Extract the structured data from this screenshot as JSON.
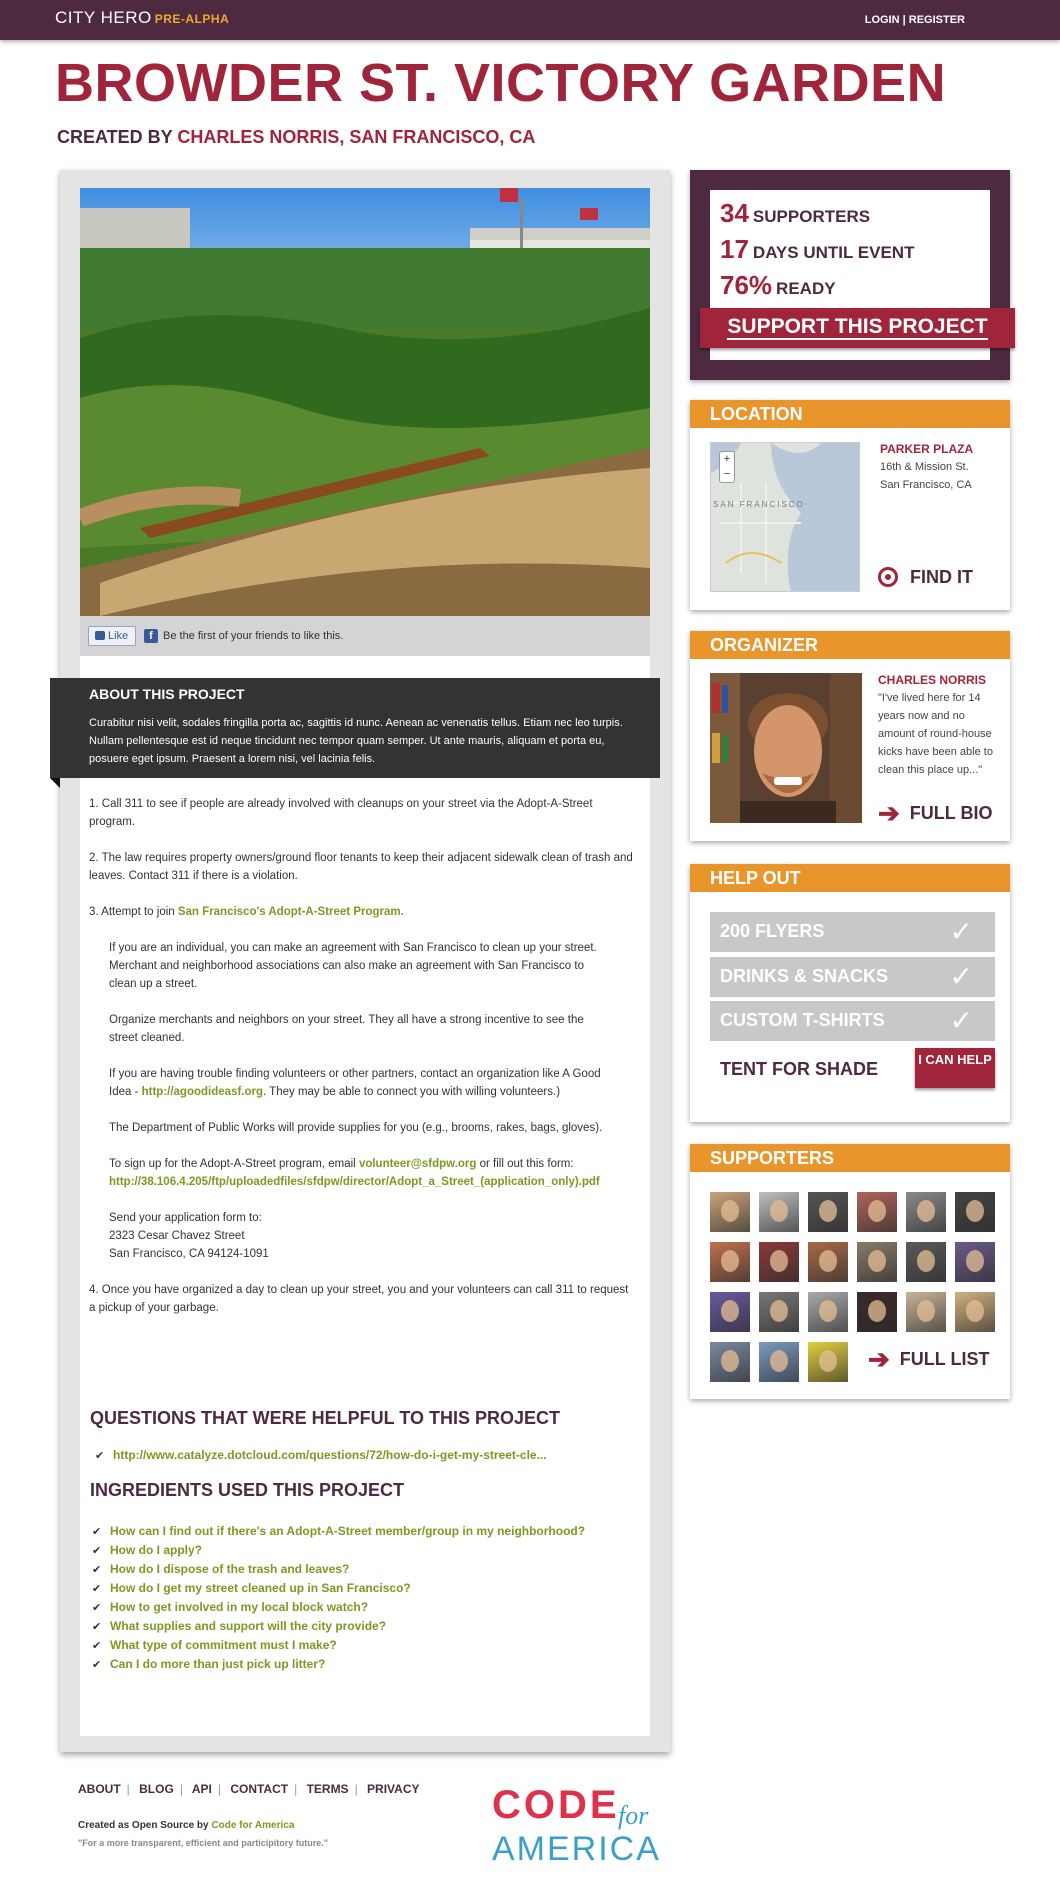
{
  "topbar": {
    "brand": "CITY HERO",
    "badge": "PRE-ALPHA",
    "login": "LOGIN",
    "separator": "|",
    "register": "REGISTER"
  },
  "project": {
    "title": "BROWDER ST. VICTORY GARDEN",
    "created_by_label": "CREATED BY",
    "creator": "CHARLES NORRIS, SAN FRANCISCO, CA"
  },
  "like_bar": {
    "button": "Like",
    "text": "Be the first of your friends to like this."
  },
  "about": {
    "heading": "ABOUT THIS PROJECT",
    "text": "Curabitur nisi velit, sodales fringilla porta ac, sagittis id nunc. Aenean ac venenatis tellus. Etiam nec leo turpis. Nullam pellentesque est id neque tincidunt nec tempor quam semper. Ut ante mauris, aliquam et porta eu, posuere eget ipsum. Praesent a lorem nisi, vel lacinia felis."
  },
  "steps": {
    "s1": "1. Call 311 to see if people are already involved with cleanups on your street via the Adopt-A-Street program.",
    "s2": "2. The law requires property owners/ground floor tenants to keep their adjacent sidewalk clean of trash and leaves. Contact 311 if there is a violation.",
    "s3_prefix": "3. Attempt to join ",
    "s3_link": "San Francisco's Adopt-A-Street Program.",
    "p1": "If you are an individual, you can make an agreement with San Francisco to clean up your street. Merchant and neighborhood associations can also make an agreement with San Francisco to clean up a street.",
    "p2": "Organize merchants and neighbors on your street. They all have a strong incentive to see the street cleaned.",
    "p3_prefix": "If you are having trouble finding volunteers or other partners, contact an organization like A Good Idea - ",
    "p3_link": "http://agoodideasf.org",
    "p3_suffix": ". They may be able to connect you with willing volunteers.)",
    "p4": "The Department of Public Works will provide supplies for you (e.g., brooms, rakes, bags, gloves).",
    "p5_prefix": "To sign up for the Adopt-A-Street program, email ",
    "p5_email": "volunteer@sfdpw.org",
    "p5_mid": " or fill out this form:",
    "p5_link": "http://38.106.4.205/ftp/uploadedfiles/sfdpw/director/Adopt_a_Street_(application_only).pdf",
    "p6_line1": "Send your application form to:",
    "p6_line2": "2323 Cesar Chavez Street",
    "p6_line3": "San Francisco, CA 94124-1091",
    "s4": "4. Once you have organized a day to clean up your street, you and your volunteers can call 311 to request a pickup of your garbage."
  },
  "questions": {
    "heading": "QUESTIONS THAT WERE HELPFUL TO THIS PROJECT",
    "items": [
      "http://www.catalyze.dotcloud.com/questions/72/how-do-i-get-my-street-cle..."
    ]
  },
  "ingredients": {
    "heading": "INGREDIENTS USED THIS PROJECT",
    "items": [
      "How can I find out if there's an Adopt-A-Street member/group in my neighborhood?",
      "How do I apply?",
      "How do I dispose of the trash and leaves?",
      "How do I get my street cleaned up in San Francisco?",
      "How to get involved in my local block watch?",
      "What supplies and support will the city provide?",
      "What type of commitment must I make?",
      "Can I do more than just pick up litter?"
    ]
  },
  "stats": {
    "supporters_num": "34",
    "supporters_label": "SUPPORTERS",
    "days_num": "17",
    "days_label": "DAYS UNTIL EVENT",
    "ready_num": "76%",
    "ready_label": "READY",
    "support_button": "SUPPORT THIS PROJECT"
  },
  "location": {
    "heading": "LOCATION",
    "name": "PARKER PLAZA",
    "line1": "16th & Mission St.",
    "line2": "San Francisco, CA",
    "map_label": "SAN FRANCISCO",
    "find_it": "FIND IT"
  },
  "organizer": {
    "heading": "ORGANIZER",
    "name": "CHARLES NORRIS",
    "quote": "\"I've lived here for 14 years now and no amount of round-house kicks have been able to clean this place up...\"",
    "full_bio": "FULL BIO"
  },
  "help_out": {
    "heading": "HELP OUT",
    "done": [
      "200 FLYERS",
      "DRINKS & SNACKS",
      "CUSTOM T-SHIRTS"
    ],
    "open": "TENT FOR SHADE",
    "can_help": "I CAN HELP"
  },
  "supporters": {
    "heading": "SUPPORTERS",
    "full_list": "FULL LIST",
    "avatar_colors": [
      "#c9a47a",
      "#bfbfbf",
      "#555555",
      "#b0645a",
      "#8a8a8a",
      "#444444",
      "#c07050",
      "#8a3a3a",
      "#a86a4a",
      "#8a7a6a",
      "#5a5a5a",
      "#6a5a8a",
      "#6a5aa0",
      "#777777",
      "#aaaaaa",
      "#3a2a2a",
      "#c8b49a",
      "#d0b080",
      "#7a8aa0",
      "#7a9ac0",
      "#e0d040"
    ]
  },
  "footer": {
    "links": [
      "ABOUT",
      "BLOG",
      "API",
      "CONTACT",
      "TERMS",
      "PRIVACY"
    ],
    "made_prefix": "Created as Open Source by ",
    "made_link": "Code for America",
    "tagline": "\"For a more transparent, efficient and participitory future.\"",
    "logo_code": "CODE",
    "logo_for": "for",
    "logo_america": "AMERICA"
  }
}
